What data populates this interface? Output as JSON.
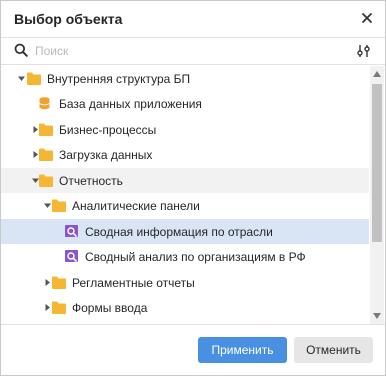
{
  "dialog": {
    "title": "Выбор объекта"
  },
  "search": {
    "placeholder": "Поиск",
    "value": ""
  },
  "tree": {
    "items": [
      {
        "label": "Внутренняя структура БП",
        "icon": "folder-icon",
        "expanded": true
      },
      {
        "label": "База данных приложения",
        "icon": "database-icon"
      },
      {
        "label": "Бизнес-процессы",
        "icon": "folder-icon",
        "expanded": false
      },
      {
        "label": "Загрузка данных",
        "icon": "folder-icon",
        "expanded": false
      },
      {
        "label": "Отчетность",
        "icon": "folder-icon",
        "expanded": true
      },
      {
        "label": "Аналитические панели",
        "icon": "folder-icon",
        "expanded": true
      },
      {
        "label": "Сводная информация по отрасли",
        "icon": "dashboard-icon",
        "selected": true
      },
      {
        "label": "Сводный анализ по организациям в РФ",
        "icon": "dashboard-icon"
      },
      {
        "label": "Регламентные отчеты",
        "icon": "folder-icon",
        "expanded": false
      },
      {
        "label": "Формы ввода",
        "icon": "folder-icon",
        "expanded": false
      }
    ]
  },
  "footer": {
    "apply_label": "Применить",
    "cancel_label": "Отменить"
  },
  "colors": {
    "accent": "#4a90e2",
    "selected_row": "#d9e5f5",
    "folder": "#f5b633",
    "database": "#f0a32e",
    "dashboard": "#8a56c8"
  }
}
